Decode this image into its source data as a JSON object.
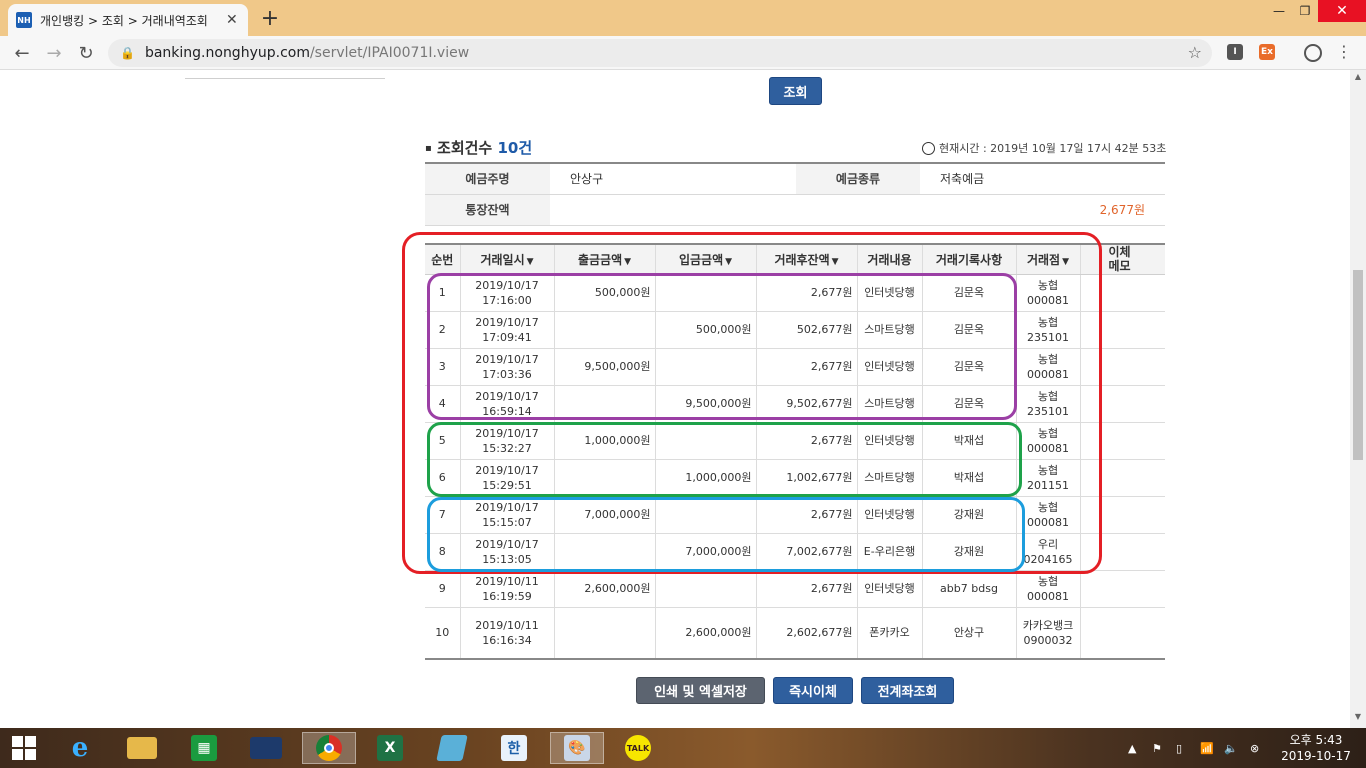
{
  "browser": {
    "tab_favicon": "NH",
    "tab_title": "개인뱅킹 > 조회 > 거래내역조회",
    "url_host": "banking.nonghyup.com",
    "url_path": "/servlet/IPAI0071I.view",
    "ext_a": "I",
    "ext_b": "Ex"
  },
  "page": {
    "search_button": "조회",
    "count_label": "조회건수",
    "count_value": "10건",
    "current_time": "현재시간 : 2019년 10월 17일 17시 42분 53초",
    "info": {
      "depositor_label": "예금주명",
      "depositor_value": "안상구",
      "type_label": "예금종류",
      "type_value": "저축예금",
      "balance_label": "통장잔액",
      "balance_value": "2,677원"
    },
    "table": {
      "headers": [
        "순번",
        "거래일시",
        "출금금액",
        "입금금액",
        "거래후잔액",
        "거래내용",
        "거래기록사항",
        "거래점",
        "이체\n메모"
      ],
      "rows": [
        {
          "no": "1",
          "date": "2019/10/17",
          "time": "17:16:00",
          "out": "500,000원",
          "in": "",
          "bal": "2,677원",
          "desc": "인터넷당행",
          "memo": "김문옥",
          "branch": "농협 000081"
        },
        {
          "no": "2",
          "date": "2019/10/17",
          "time": "17:09:41",
          "out": "",
          "in": "500,000원",
          "bal": "502,677원",
          "desc": "스마트당행",
          "memo": "김문옥",
          "branch": "농협 235101"
        },
        {
          "no": "3",
          "date": "2019/10/17",
          "time": "17:03:36",
          "out": "9,500,000원",
          "in": "",
          "bal": "2,677원",
          "desc": "인터넷당행",
          "memo": "김문옥",
          "branch": "농협 000081"
        },
        {
          "no": "4",
          "date": "2019/10/17",
          "time": "16:59:14",
          "out": "",
          "in": "9,500,000원",
          "bal": "9,502,677원",
          "desc": "스마트당행",
          "memo": "김문옥",
          "branch": "농협 235101"
        },
        {
          "no": "5",
          "date": "2019/10/17",
          "time": "15:32:27",
          "out": "1,000,000원",
          "in": "",
          "bal": "2,677원",
          "desc": "인터넷당행",
          "memo": "박재섭",
          "branch": "농협 000081"
        },
        {
          "no": "6",
          "date": "2019/10/17",
          "time": "15:29:51",
          "out": "",
          "in": "1,000,000원",
          "bal": "1,002,677원",
          "desc": "스마트당행",
          "memo": "박재섭",
          "branch": "농협 201151"
        },
        {
          "no": "7",
          "date": "2019/10/17",
          "time": "15:15:07",
          "out": "7,000,000원",
          "in": "",
          "bal": "2,677원",
          "desc": "인터넷당행",
          "memo": "강재원",
          "branch": "농협 000081"
        },
        {
          "no": "8",
          "date": "2019/10/17",
          "time": "15:13:05",
          "out": "",
          "in": "7,000,000원",
          "bal": "7,002,677원",
          "desc": "E-우리은행",
          "memo": "강재원",
          "branch": "우리 0204165"
        },
        {
          "no": "9",
          "date": "2019/10/11",
          "time": "16:19:59",
          "out": "2,600,000원",
          "in": "",
          "bal": "2,677원",
          "desc": "인터넷당행",
          "memo": "abb7 bdsg",
          "branch": "농협 000081"
        },
        {
          "no": "10",
          "date": "2019/10/11",
          "time": "16:16:34",
          "out": "",
          "in": "2,600,000원",
          "bal": "2,602,677원",
          "desc": "폰카카오",
          "memo": "안상구",
          "branch": "카카오뱅크 0900032"
        }
      ]
    },
    "buttons": {
      "print": "인쇄 및 엑셀저장",
      "transfer": "즉시이체",
      "all_accounts": "전계좌조회"
    }
  },
  "taskbar": {
    "clock_time": "오후 5:43",
    "clock_date": "2019-10-17",
    "kakao": "TALK"
  }
}
